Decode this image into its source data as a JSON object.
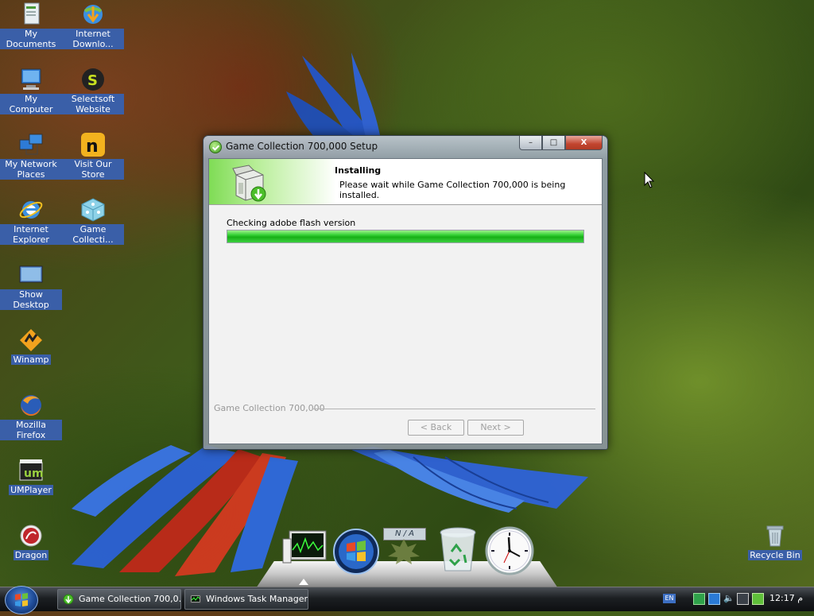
{
  "desktop": {
    "icons": [
      {
        "label": "My Documents",
        "icon": "my-documents-icon"
      },
      {
        "label": "Internet Downlo...",
        "icon": "internet-download-icon"
      },
      {
        "label": "My Computer",
        "icon": "my-computer-icon"
      },
      {
        "label": "Selectsoft Website",
        "icon": "selectsoft-icon"
      },
      {
        "label": "My Network Places",
        "icon": "network-places-icon"
      },
      {
        "label": "Visit Our Store",
        "icon": "store-icon"
      },
      {
        "label": "Internet Explorer",
        "icon": "internet-explorer-icon"
      },
      {
        "label": "Game Collecti...",
        "icon": "game-collection-icon"
      },
      {
        "label": "Show Desktop",
        "icon": "show-desktop-icon"
      },
      {
        "label": "Winamp",
        "icon": "winamp-icon"
      },
      {
        "label": "Mozilla Firefox",
        "icon": "firefox-icon"
      },
      {
        "label": "UMPlayer",
        "icon": "umplayer-icon"
      },
      {
        "label": "Dragon",
        "icon": "dragon-icon"
      },
      {
        "label": "Recycle Bin",
        "icon": "recycle-bin-icon"
      }
    ]
  },
  "window": {
    "title": "Game Collection 700,000 Setup",
    "header_title": "Installing",
    "header_subtitle": "Please wait while Game Collection 700,000 is being installed.",
    "status_text": "Checking adobe flash version",
    "progress": 1.0,
    "brand_text": "Game Collection 700,000",
    "back_label": "< Back",
    "next_label": "Next >",
    "controls": {
      "minimize": "–",
      "maximize": "□",
      "close": "X"
    }
  },
  "dock": {
    "items": [
      "task-manager-monitor-icon",
      "windows-orb-icon",
      "weather-na-icon",
      "recycle-bin-icon",
      "clock-gadget-icon"
    ],
    "weather_label": "N / A"
  },
  "taskbar": {
    "tasks": [
      {
        "label": "Game Collection 700,0...",
        "active": true
      },
      {
        "label": "Windows Task Manager",
        "active": false
      }
    ],
    "lang": "EN",
    "clock": "12:17 م"
  }
}
